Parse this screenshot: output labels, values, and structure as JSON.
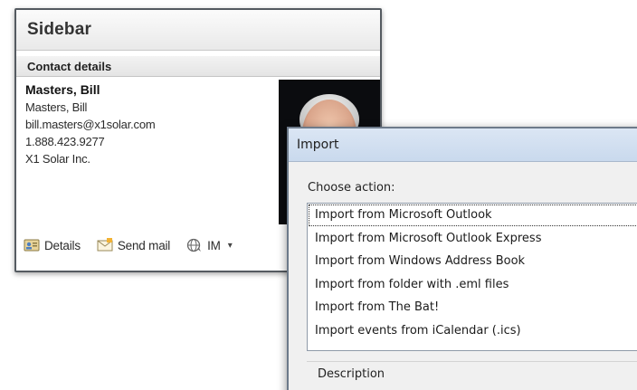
{
  "sidebar": {
    "title": "Sidebar",
    "section_header": "Contact details",
    "contact": {
      "display_name": "Masters, Bill",
      "name": "Masters, Bill",
      "email": "bill.masters@x1solar.com",
      "phone": "1.888.423.9277",
      "company": "X1 Solar Inc."
    },
    "actions": {
      "details_label": "Details",
      "send_mail_label": "Send mail",
      "im_label": "IM",
      "details_icon": "contact-card-icon",
      "send_mail_icon": "envelope-icon",
      "im_icon": "chat-globe-icon"
    }
  },
  "import_dialog": {
    "title": "Import",
    "choose_label": "Choose action:",
    "options": [
      {
        "label": "Import from Microsoft Outlook",
        "selected": true
      },
      {
        "label": "Import from Microsoft Outlook Express",
        "selected": false
      },
      {
        "label": "Import from Windows Address Book",
        "selected": false
      },
      {
        "label": "Import from folder with .eml files",
        "selected": false
      },
      {
        "label": "Import from The Bat!",
        "selected": false
      },
      {
        "label": "Import events from iCalendar (.ics)",
        "selected": false
      }
    ],
    "description_label": "Description"
  },
  "colors": {
    "sidebar_border": "#555b61",
    "dialog_title_bg": "#c9d9ed",
    "dialog_bg": "#f0f0f0"
  }
}
